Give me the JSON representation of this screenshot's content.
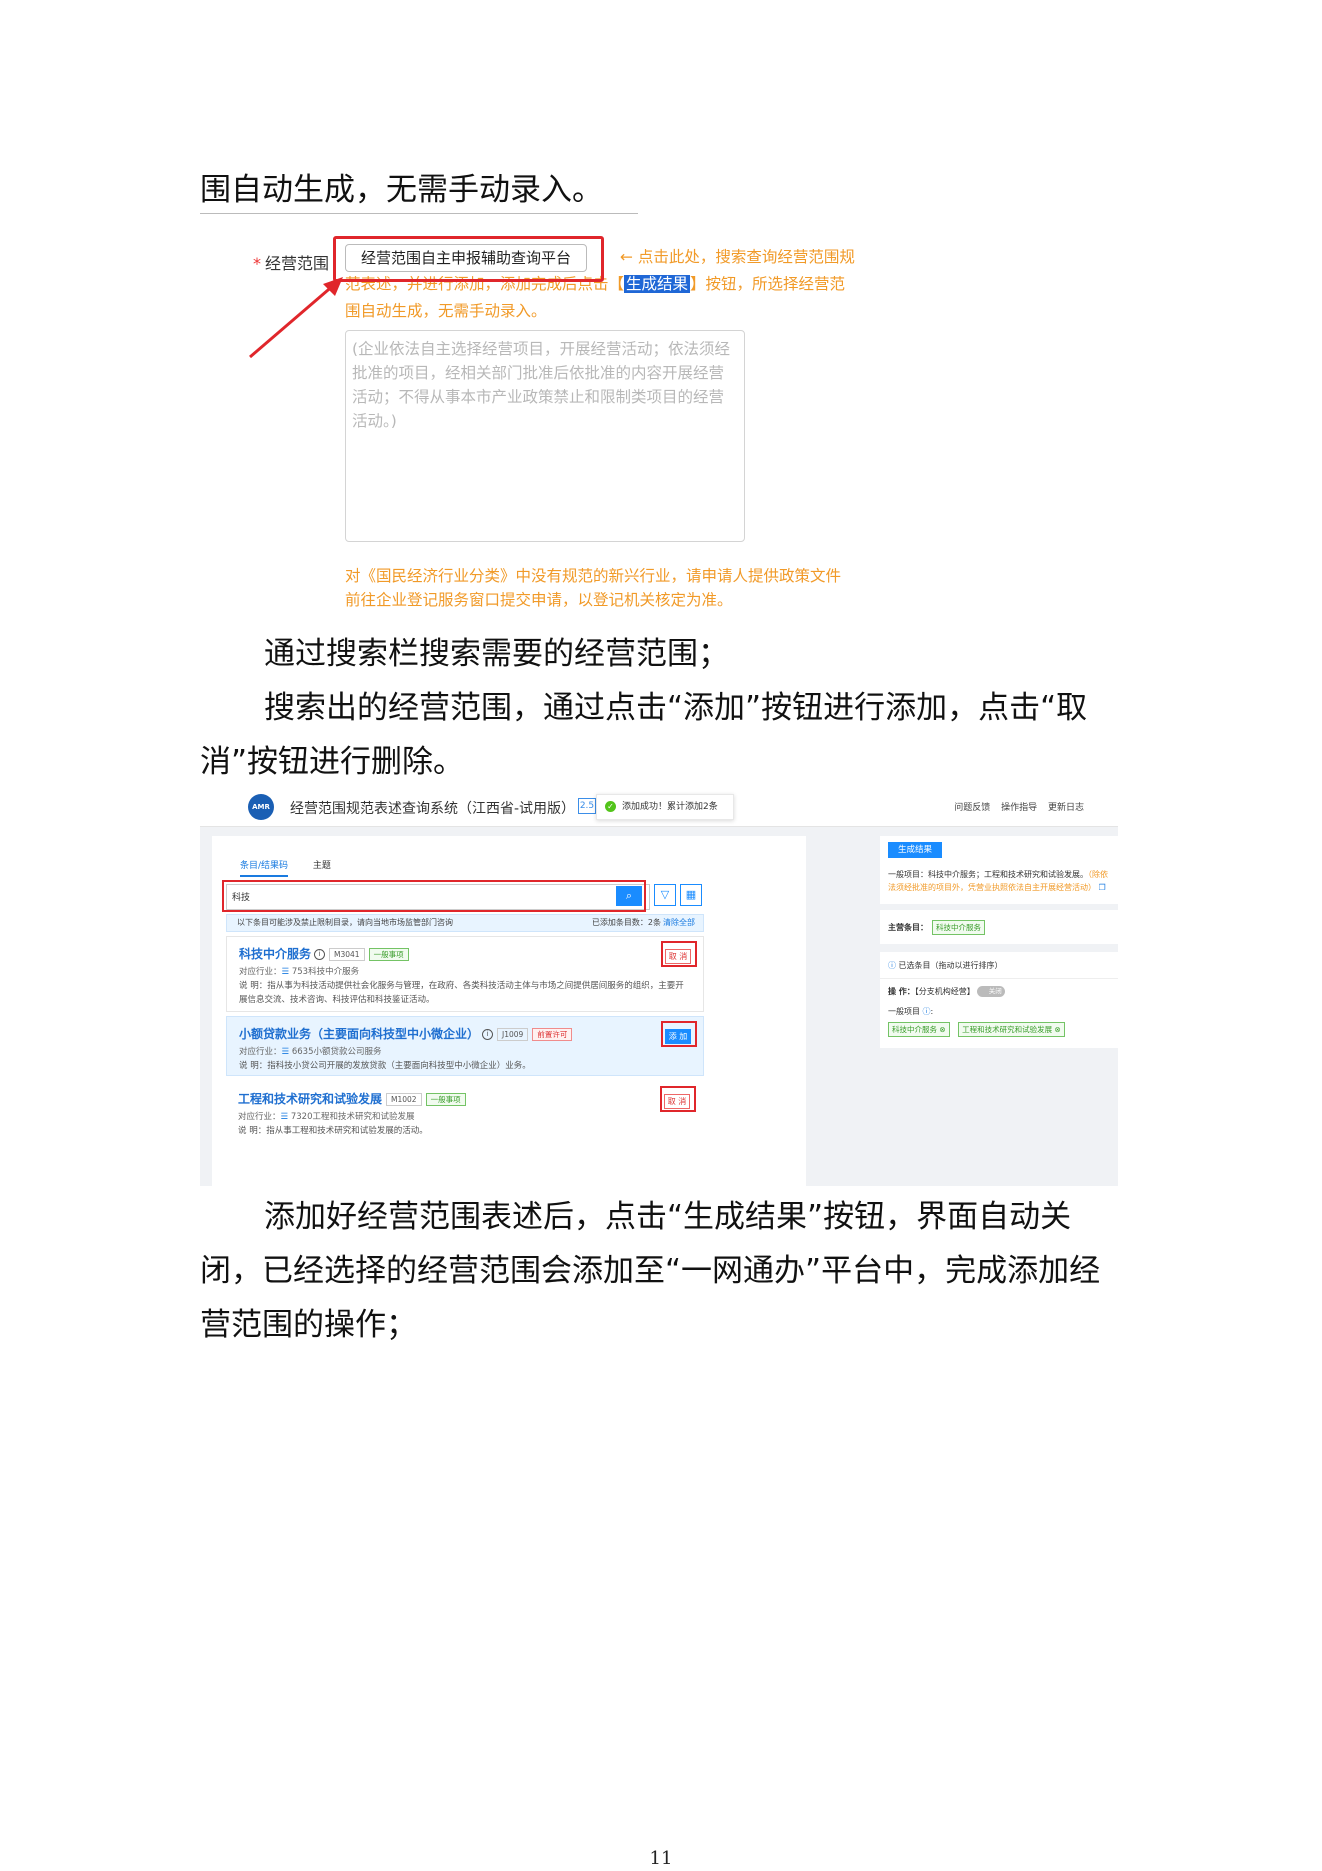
{
  "paragraphs": {
    "p0": "围自动生成，无需手动录入。",
    "p1": "通过搜索栏搜索需要的经营范围；",
    "p2": "搜索出的经营范围，通过点击“添加”按钮进行添加，点击“取消”按钮进行删除。",
    "p3": "添加好经营范围表述后，点击“生成结果”按钮，界面自动关闭，已经选择的经营范围会添加至“一网通办”平台中，完成添加经营范围的操作；"
  },
  "screenshot1": {
    "required_mark": "*",
    "label": "经营范围",
    "platform_button": "经营范围自主申报辅助查询平台",
    "hint_part1": "点击此处，搜索查询经营范围规范表述，并进行添加，添加完成后点击【",
    "hint_highlight": "生成结果",
    "hint_part2": "】按钮，所选择经营范围自动生成，无需手动录入。",
    "placeholder": "(企业依法自主选择经营项目，开展经营活动；依法须经批准的项目，经相关部门批准后依批准的内容开展经营活动；不得从事本市产业政策禁止和限制类项目的经营活动。)",
    "note": "对《国民经济行业分类》中没有规范的新兴行业，请申请人提供政策文件前往企业登记服务窗口提交申请，以登记机关核定为准。"
  },
  "screenshot2": {
    "system_title": "经营范围规范表述查询系统（江西省-试用版）",
    "version": "2.5",
    "toast": "添加成功！累计添加2条",
    "header_links": [
      "问题反馈",
      "操作指导",
      "更新日志"
    ],
    "tabs": [
      "条目/结果码",
      "主题"
    ],
    "search_value": "科技",
    "filter_bar_left": "以下条目可能涉及禁止限制目录，请向当地市场监管部门咨询",
    "filter_bar_right": "已添加条目数：2条",
    "clear_all": "清除全部",
    "items": [
      {
        "name": "科技中介服务",
        "code": "M3041",
        "tag": "一般事项",
        "industry_label": "对应行业：",
        "industry": "753科技中介服务",
        "desc_label": "说    明：",
        "desc": "指从事为科技活动提供社会化服务与管理，在政府、各类科技活动主体与市场之间提供居间服务的组织，主要开展信息交流、技术咨询、科技评估和科技鉴证活动。",
        "action": "取 消"
      },
      {
        "name": "小额贷款业务（主要面向科技型中小微企业）",
        "code": "J1009",
        "tag": "前置许可",
        "industry_label": "对应行业：",
        "industry": "6635小额贷款公司服务",
        "desc_label": "说    明：",
        "desc": "指科技小贷公司开展的发放贷款（主要面向科技型中小微企业）业务。",
        "action": "添 加"
      },
      {
        "name": "工程和技术研究和试验发展",
        "code": "M1002",
        "tag": "一般事项",
        "industry_label": "对应行业：",
        "industry": "7320工程和技术研究和试验发展",
        "desc_label": "说    明：",
        "desc": "指从事工程和技术研究和试验发展的活动。",
        "action": "取 消"
      }
    ],
    "generate_button": "生成结果",
    "result_text": "一般项目：科技中介服务；工程和技术研究和试验发展。",
    "result_note": "（除依法须经批准的项目外，凭营业执照依法自主开展经营活动）",
    "main_item_label": "主营条目：",
    "main_item": "科技中介服务",
    "selected_label": "已选条目（拖动以进行排序）",
    "operation_label": "操        作：",
    "operation_value": "【分支机构经营】",
    "toggle_label": "关闭",
    "general_label": "一般项目",
    "chips": [
      "科技中介服务",
      "工程和技术研究和试验发展"
    ]
  },
  "page_number": "11"
}
